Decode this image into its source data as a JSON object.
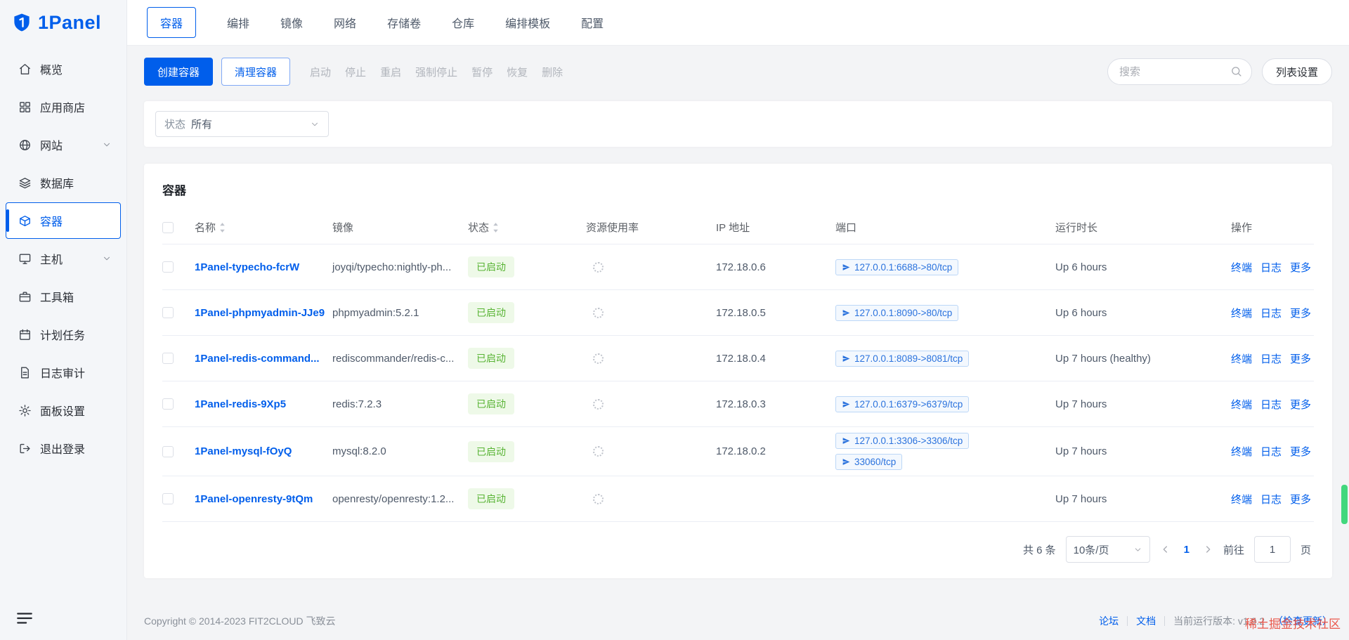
{
  "app": {
    "logo_text": "1Panel",
    "watermark": "稀土掘金技术社区"
  },
  "sidebar": {
    "items": [
      {
        "id": "overview",
        "icon": "home",
        "label": "概览"
      },
      {
        "id": "app-store",
        "icon": "grid",
        "label": "应用商店"
      },
      {
        "id": "website",
        "icon": "globe",
        "label": "网站",
        "expandable": true
      },
      {
        "id": "database",
        "icon": "database",
        "label": "数据库"
      },
      {
        "id": "container",
        "icon": "container",
        "label": "容器",
        "active": true
      },
      {
        "id": "host",
        "icon": "host",
        "label": "主机",
        "expandable": true
      },
      {
        "id": "toolbox",
        "icon": "toolbox",
        "label": "工具箱"
      },
      {
        "id": "cronjob",
        "icon": "calendar",
        "label": "计划任务"
      },
      {
        "id": "log-audit",
        "icon": "log",
        "label": "日志审计"
      },
      {
        "id": "panel-settings",
        "icon": "gear",
        "label": "面板设置"
      },
      {
        "id": "logout",
        "icon": "logout",
        "label": "退出登录"
      }
    ]
  },
  "tabs": [
    {
      "id": "container",
      "label": "容器",
      "active": true
    },
    {
      "id": "compose",
      "label": "编排"
    },
    {
      "id": "image",
      "label": "镜像"
    },
    {
      "id": "network",
      "label": "网络"
    },
    {
      "id": "volume",
      "label": "存储卷"
    },
    {
      "id": "repo",
      "label": "仓库"
    },
    {
      "id": "compose-template",
      "label": "编排模板"
    },
    {
      "id": "setting",
      "label": "配置"
    }
  ],
  "toolbar": {
    "create": "创建容器",
    "clean": "清理容器",
    "actions": [
      {
        "id": "start",
        "label": "启动"
      },
      {
        "id": "stop",
        "label": "停止"
      },
      {
        "id": "restart",
        "label": "重启"
      },
      {
        "id": "force-stop",
        "label": "强制停止"
      },
      {
        "id": "pause",
        "label": "暂停"
      },
      {
        "id": "resume",
        "label": "恢复"
      },
      {
        "id": "delete",
        "label": "删除"
      }
    ],
    "search_placeholder": "搜索",
    "column_settings": "列表设置"
  },
  "filter": {
    "label": "状态",
    "value": "所有"
  },
  "table": {
    "title": "容器",
    "columns": [
      {
        "id": "name",
        "label": "名称",
        "sortable": true
      },
      {
        "id": "image",
        "label": "镜像"
      },
      {
        "id": "status",
        "label": "状态",
        "sortable": true
      },
      {
        "id": "resource",
        "label": "资源使用率"
      },
      {
        "id": "ip",
        "label": "IP 地址"
      },
      {
        "id": "port",
        "label": "端口"
      },
      {
        "id": "uptime",
        "label": "运行时长"
      },
      {
        "id": "operation",
        "label": "操作"
      }
    ],
    "row_actions": [
      {
        "id": "terminal",
        "label": "终端"
      },
      {
        "id": "logs",
        "label": "日志"
      },
      {
        "id": "more",
        "label": "更多"
      }
    ],
    "rows": [
      {
        "name": "1Panel-typecho-fcrW",
        "image": "joyqi/typecho:nightly-ph...",
        "status": "已启动",
        "ip": "172.18.0.6",
        "ports": [
          "127.0.0.1:6688->80/tcp"
        ],
        "uptime": "Up 6 hours"
      },
      {
        "name": "1Panel-phpmyadmin-JJe9",
        "image": "phpmyadmin:5.2.1",
        "status": "已启动",
        "ip": "172.18.0.5",
        "ports": [
          "127.0.0.1:8090->80/tcp"
        ],
        "uptime": "Up 6 hours"
      },
      {
        "name": "1Panel-redis-command...",
        "image": "rediscommander/redis-c...",
        "status": "已启动",
        "ip": "172.18.0.4",
        "ports": [
          "127.0.0.1:8089->8081/tcp"
        ],
        "uptime": "Up 7 hours (healthy)"
      },
      {
        "name": "1Panel-redis-9Xp5",
        "image": "redis:7.2.3",
        "status": "已启动",
        "ip": "172.18.0.3",
        "ports": [
          "127.0.0.1:6379->6379/tcp"
        ],
        "uptime": "Up 7 hours"
      },
      {
        "name": "1Panel-mysql-fOyQ",
        "image": "mysql:8.2.0",
        "status": "已启动",
        "ip": "172.18.0.2",
        "ports": [
          "127.0.0.1:3306->3306/tcp",
          "33060/tcp"
        ],
        "uptime": "Up 7 hours"
      },
      {
        "name": "1Panel-openresty-9tQm",
        "image": "openresty/openresty:1.2...",
        "status": "已启动",
        "ip": "",
        "ports": [],
        "uptime": "Up 7 hours"
      }
    ]
  },
  "pagination": {
    "total": "共 6 条",
    "page_size": "10条/页",
    "current": "1",
    "goto_label": "前往",
    "goto_value": "1",
    "page_unit": "页"
  },
  "footer": {
    "copyright": "Copyright © 2014-2023 FIT2CLOUD 飞致云",
    "links": [
      {
        "id": "forum",
        "label": "论坛"
      },
      {
        "id": "docs",
        "label": "文档"
      }
    ],
    "version_label": "当前运行版本: v1.9.2",
    "check_update": "（检查更新）"
  },
  "colors": {
    "primary": "#005eeb",
    "success": "#58b434",
    "watermark_red": "#e9493c",
    "scrollbar_green": "#42d77d"
  }
}
